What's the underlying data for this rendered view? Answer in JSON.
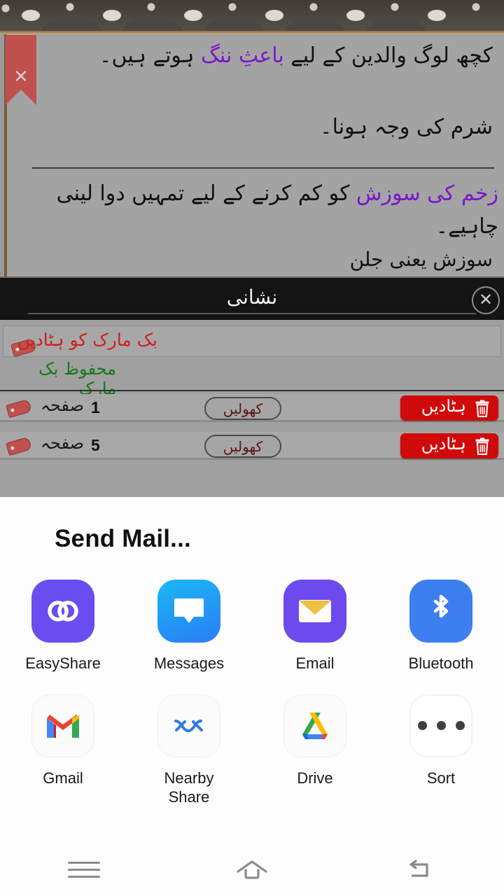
{
  "reader": {
    "verse_1": "کچھ لوگ والدین کے لیے <hl>باعثِ ننگ</hl> ہوتے ہیں۔",
    "verse_1_note": "شرم کی وجہ ہونا۔",
    "verse_2": "<hl>زخم کی سوزش</hl> کو کم کرنے کے لیے تمہیں دوا لینی چاہیے۔",
    "verse_2_note": "سوزش یعنی جلن",
    "ribbon_icon": "bookmark-ribbon-close-icon",
    "ribbon_glyph": "✕"
  },
  "bookmark_dialog": {
    "title": "نشانی",
    "close_glyph": "✕",
    "remove_all_label": "بک مارک کو ہٹادیں",
    "saved_label": "محفوظ بک مارک",
    "accent_red": "#d21e1e",
    "accent_green": "#127a19",
    "delete_button_color": "#d00a0a",
    "rows": [
      {
        "tag_icon": "bookmark-tag-icon",
        "page_label": "صفحہ",
        "page_number": "1",
        "open_label": "کھولیں",
        "delete_label": "ہٹادیں",
        "delete_icon": "trash-icon"
      },
      {
        "tag_icon": "bookmark-tag-icon",
        "page_label": "صفحہ",
        "page_number": "5",
        "open_label": "کھولیں",
        "delete_label": "ہٹادیں",
        "delete_icon": "trash-icon"
      }
    ]
  },
  "share_sheet": {
    "title": "Send Mail...",
    "apps": [
      {
        "label": "EasyShare",
        "icon": "easyshare-icon"
      },
      {
        "label": "Messages",
        "icon": "messages-icon"
      },
      {
        "label": "Email",
        "icon": "email-icon"
      },
      {
        "label": "Bluetooth",
        "icon": "bluetooth-icon"
      },
      {
        "label": "Gmail",
        "icon": "gmail-icon"
      },
      {
        "label": "Nearby\nShare",
        "icon": "nearby-share-icon"
      },
      {
        "label": "Drive",
        "icon": "google-drive-icon"
      },
      {
        "label": "Sort",
        "icon": "more-options-icon"
      }
    ]
  },
  "navbar": {
    "recents": "recents-icon",
    "home": "home-icon",
    "back": "back-icon"
  }
}
